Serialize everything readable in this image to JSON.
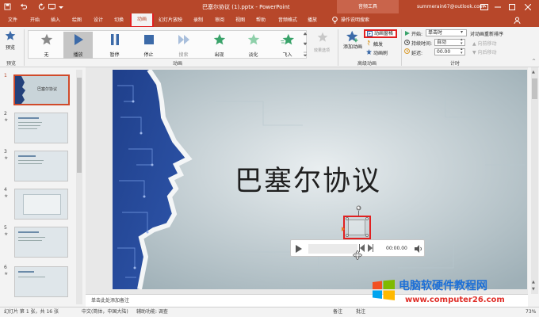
{
  "title_bar": {
    "doc_title": "巴塞尔协议 (1).pptx  -  PowerPoint",
    "context_tool": "音频工具",
    "account": "summerain67@outlook.com"
  },
  "tabs": [
    {
      "label": "文件"
    },
    {
      "label": "开始"
    },
    {
      "label": "插入"
    },
    {
      "label": "绘图"
    },
    {
      "label": "设计"
    },
    {
      "label": "切换"
    },
    {
      "label": "动画"
    },
    {
      "label": "幻灯片放映"
    },
    {
      "label": "录制"
    },
    {
      "label": "审阅"
    },
    {
      "label": "视图"
    },
    {
      "label": "帮助"
    },
    {
      "label": "音频格式"
    },
    {
      "label": "播放"
    }
  ],
  "tell_me": "操作说明搜索",
  "ribbon": {
    "preview_label": "预览",
    "preview_group": "预览",
    "animations_group": "动画",
    "advanced_group": "高级动画",
    "timing_group": "计时",
    "gallery": [
      "无",
      "播放",
      "暂停",
      "停止",
      "搜索",
      "出现",
      "淡化",
      "飞入"
    ],
    "effect_options": "效果选项",
    "add_animation": "添加动画",
    "animation_pane": "动画窗格",
    "trigger": "触发",
    "animation_painter": "动画刷",
    "start_label": "开始:",
    "start_value": "单击时",
    "duration_label": "持续时间:",
    "duration_value": "自动",
    "delay_label": "延迟:",
    "delay_value": "00.00",
    "reorder_title": "对动画重新排序",
    "move_earlier": "向前移动",
    "move_later": "向后移动"
  },
  "slide": {
    "title": "巴塞尔协议",
    "audio_time": "00:00.00"
  },
  "thumb_numbers": [
    "1",
    "2",
    "3",
    "4",
    "5",
    "6"
  ],
  "thumb1_text": "巴塞尔协议",
  "notes_placeholder": "单击此处添加备注",
  "status": {
    "slide_info": "幻灯片 第 1 张，共 16 张",
    "language": "中文(简体，中国大陆)",
    "accessibility": "辅助功能: 调查",
    "notes": "备注",
    "comments": "批注",
    "zoom": "73%"
  },
  "watermark": {
    "line1": "电脑软硬件教程网",
    "line2": "www.computer26.com"
  }
}
